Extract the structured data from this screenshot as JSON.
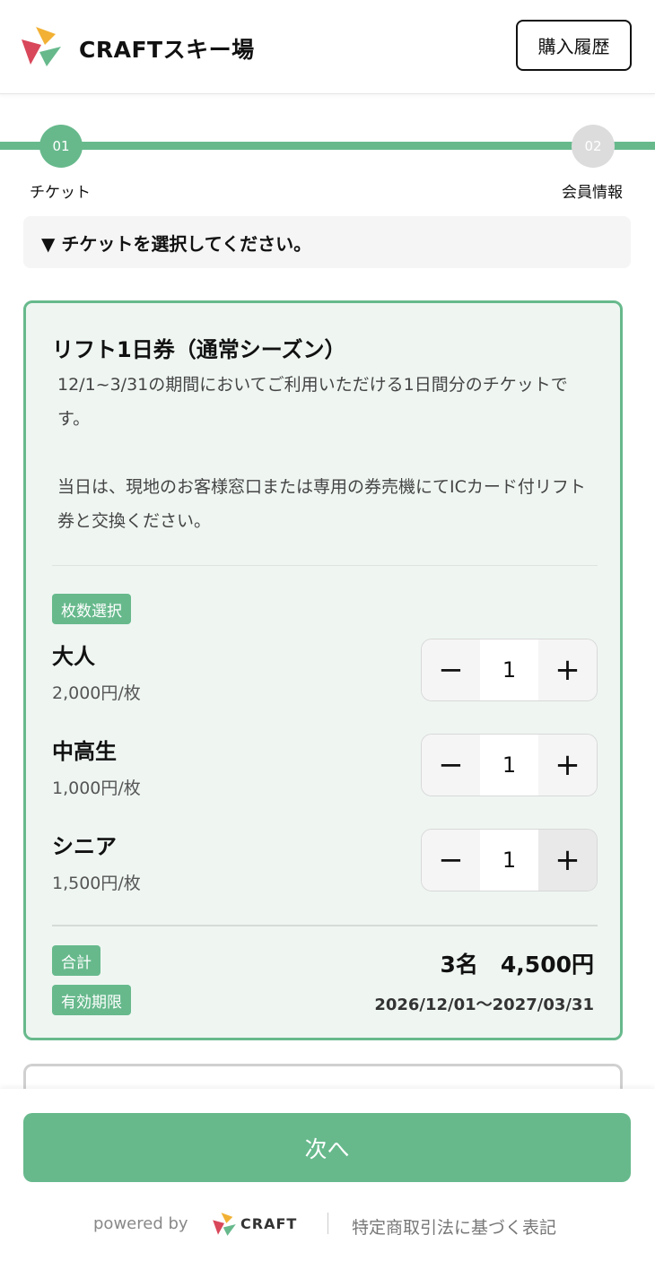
{
  "header": {
    "title": "CRAFTスキー場",
    "history_button": "購入履歴"
  },
  "steps": [
    {
      "number": "01",
      "label": "チケット"
    },
    {
      "number": "02",
      "label": "会員情報"
    }
  ],
  "instruction": "▼ チケットを選択してください。",
  "ticket": {
    "name": "リフト1日券（通常シーズン）",
    "description_1": "12/1~3/31の期間においてご利用いただける1日間分のチケットです。",
    "description_2": "当日は、現地のお客様窓口または専用の券売機にてICカード付リフト券と交換ください。",
    "quantity_badge": "枚数選択",
    "rows": [
      {
        "name": "大人",
        "price": "2,000円/枚",
        "qty": "1"
      },
      {
        "name": "中高生",
        "price": "1,000円/枚",
        "qty": "1"
      },
      {
        "name": "シニア",
        "price": "1,500円/枚",
        "qty": "1"
      }
    ],
    "minus_symbol": "−",
    "plus_symbol": "+",
    "total_badge": "合計",
    "total_value": "3名　4,500円",
    "valid_badge": "有効期限",
    "valid_value": "2026/12/01〜2027/03/31"
  },
  "footer": {
    "next_button": "次へ",
    "powered_by": "powered by",
    "brand": "CRAFT",
    "legal_link": "特定商取引法に基づく表記"
  },
  "colors": {
    "accent": "#67b98c",
    "card_bg": "#eff6f2"
  }
}
